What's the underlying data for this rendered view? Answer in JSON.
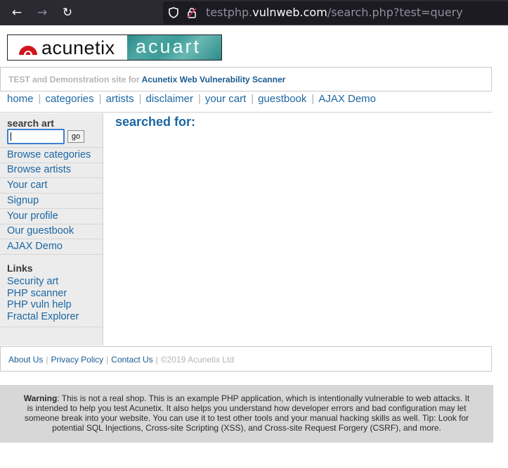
{
  "browser": {
    "url_prefix": "testphp.",
    "url_host": "vulnweb.com",
    "url_path": "/search.php?test=query"
  },
  "logo": {
    "left_text": "acunetix",
    "right_text": "acuart"
  },
  "banner": {
    "prefix": "TEST and Demonstration site for ",
    "link": "Acunetix Web Vulnerability Scanner"
  },
  "topnav": [
    "home",
    "categories",
    "artists",
    "disclaimer",
    "your cart",
    "guestbook",
    "AJAX Demo"
  ],
  "sidebar": {
    "search_heading": "search art",
    "search_value": "",
    "go_label": "go",
    "items": [
      "Browse categories",
      "Browse artists",
      "Your cart",
      "Signup",
      "Your profile",
      "Our guestbook",
      "AJAX Demo"
    ],
    "links_heading": "Links",
    "links": [
      "Security art",
      "PHP scanner",
      "PHP vuln help",
      "Fractal Explorer"
    ]
  },
  "main": {
    "heading": "searched for:"
  },
  "footer": {
    "links": [
      "About Us",
      "Privacy Policy",
      "Contact Us"
    ],
    "copyright": "©2019 Acunetix Ltd"
  },
  "warning": {
    "label": "Warning",
    "text": ": This is not a real shop. This is an example PHP application, which is intentionally vulnerable to web attacks. It is intended to help you test Acunetix. It also helps you understand how developer errors and bad configuration may let someone break into your website. You can use it to test other tools and your manual hacking skills as well. Tip: Look for potential SQL Injections, Cross-site Scripting (XSS), and Cross-site Request Forgery (CSRF), and more."
  }
}
